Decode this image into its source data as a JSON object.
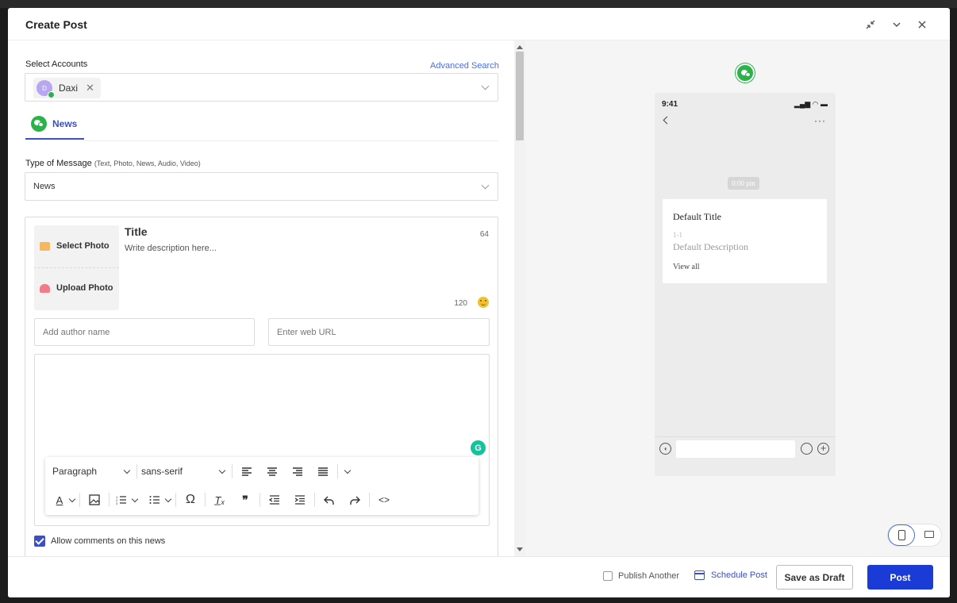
{
  "header": {
    "title": "Create Post"
  },
  "accounts": {
    "label": "Select Accounts",
    "advanced_search": "Advanced Search",
    "chip_initial": "D",
    "chip_name": "Daxi",
    "chip_remove": "✕"
  },
  "tab": {
    "label": "News"
  },
  "message_type": {
    "label": "Type of Message",
    "hint": "(Text, Photo, News, Audio, Video)",
    "value": "News"
  },
  "editor": {
    "select_photo": "Select Photo",
    "upload_photo": "Upload Photo",
    "title": "Title",
    "title_limit": "64",
    "description_placeholder": "Write description here...",
    "description_limit": "120",
    "author_placeholder": "Add author name",
    "url_placeholder": "Enter web URL",
    "grammarly": "G",
    "allow_comments": "Allow comments on this news"
  },
  "toolbar": {
    "block_format": "Paragraph",
    "font_family": "sans-serif",
    "text_color_glyph": "A",
    "special_char_glyph": "Ω",
    "clear_format_glyph": "T̲ₓ",
    "quote_glyph": "❞",
    "code_glyph": "<>"
  },
  "preview": {
    "time": "9:41",
    "status": "▂▄▆ ◠ ▬",
    "more": "···",
    "timestamp": "0:00 pm",
    "card_title": "Default Title",
    "card_date": "1-1",
    "card_description": "Default Description",
    "view_all": "View all"
  },
  "footer": {
    "publish_another": "Publish Another",
    "schedule_post": "Schedule Post",
    "save_draft": "Save as Draft",
    "post": "Post"
  },
  "colors": {
    "accent": "#3b50c8",
    "primary_button": "#1a3bd6",
    "wechat_green": "#2bb34a",
    "link": "#4a6ee0"
  },
  "icons": {
    "collapse": "collapse-icon",
    "minimize": "chevron-down-icon",
    "close": "close-icon",
    "wechat": "wechat-icon",
    "emoji": "smiley-icon",
    "calendar": "calendar-icon"
  }
}
